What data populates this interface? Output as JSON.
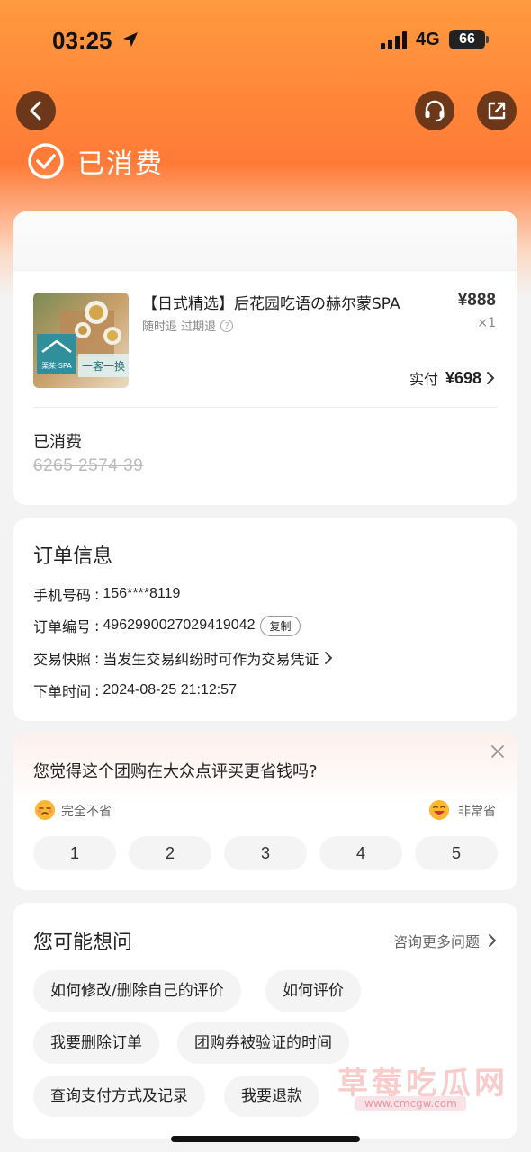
{
  "status_bar": {
    "time": "03:25",
    "network": "4G",
    "battery": "66"
  },
  "header": {
    "status_title": "已消费",
    "back_icon": "chevron-left-icon",
    "service_icon": "headset-icon",
    "share_icon": "share-icon"
  },
  "product": {
    "name": "【日式精选】后花园吃语の赫尔蒙SPA",
    "policy": "随时退 过期退",
    "price": "¥888",
    "quantity": "×1",
    "paid_label": "实付",
    "paid_value": "¥698",
    "thumb_brand": "栗茱·SPA",
    "thumb_tag": "一客一换"
  },
  "voucher": {
    "status": "已消费",
    "code": "6265 2574 39"
  },
  "order_info": {
    "title": "订单信息",
    "rows": [
      {
        "label": "手机号码",
        "sep": ":",
        "value": "156****8119"
      },
      {
        "label": "订单编号",
        "sep": ":",
        "value": "4962990027029419042",
        "action": "复制"
      },
      {
        "label": "交易快照",
        "sep": ":",
        "value": "当发生交易纠纷时可作为交易凭证"
      },
      {
        "label": "下单时间",
        "sep": ":",
        "value": "2024-08-25 21:12:57"
      }
    ]
  },
  "survey": {
    "question": "您觉得这个团购在大众点评买更省钱吗?",
    "low_label": "完全不省",
    "high_label": "非常省",
    "ratings": [
      "1",
      "2",
      "3",
      "4",
      "5"
    ]
  },
  "faq": {
    "title": "您可能想问",
    "more": "咨询更多问题",
    "chips": [
      "如何修改/删除自己的评价",
      "如何评价",
      "我要删除订单",
      "团购券被验证的时间",
      "查询支付方式及记录",
      "我要退款"
    ]
  },
  "watermark": {
    "text": "草莓吃瓜网",
    "url": "www.cmcgw.com"
  },
  "colors": {
    "header_orange": "#ff7a37",
    "card_bg": "#ffffff",
    "page_bg": "#f3f3f3"
  }
}
